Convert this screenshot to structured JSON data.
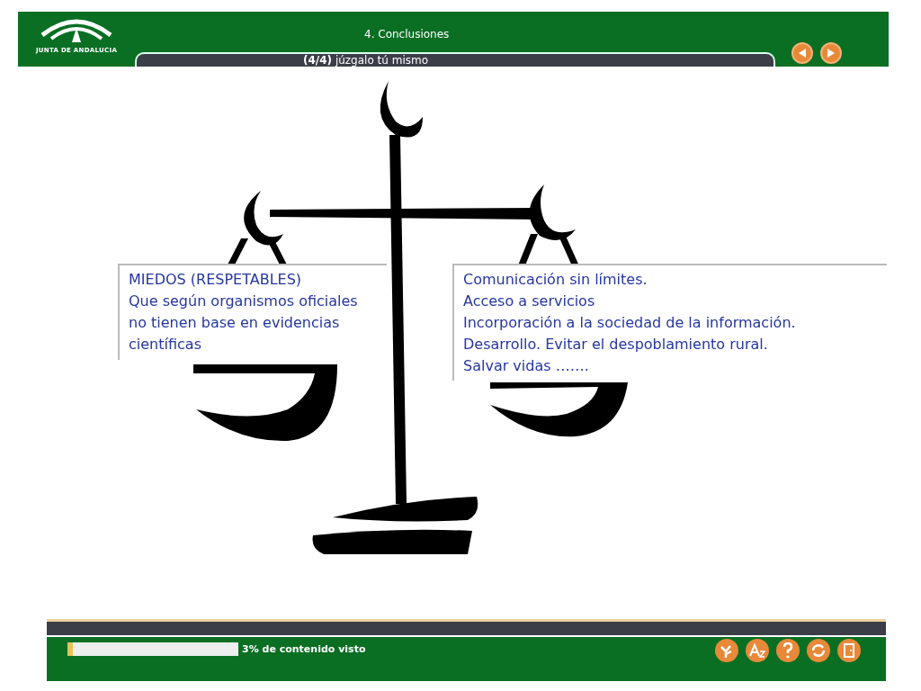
{
  "header": {
    "logo_text": "JUNTA DE ANDALUCIA",
    "title": "4. Conclusiones",
    "subtitle": "**(4/4)** júzgalo tú mismo"
  },
  "panels": [
    {
      "lines": [
        "MIEDOS (RESPETABLES)",
        "Que según organismos oficiales no tienen base en evidencias científicas"
      ]
    },
    {
      "lines": [
        "Comunicación sin límites.",
        "Acceso a servicios",
        "Incorporación a la sociedad de la información.",
        "Desarrollo. Evitar el despoblamiento rural.",
        "Salvar vidas ……."
      ]
    }
  ],
  "footer": {
    "progress": {
      "level": 0.03,
      "label": "3% de contenido visto"
    }
  }
}
